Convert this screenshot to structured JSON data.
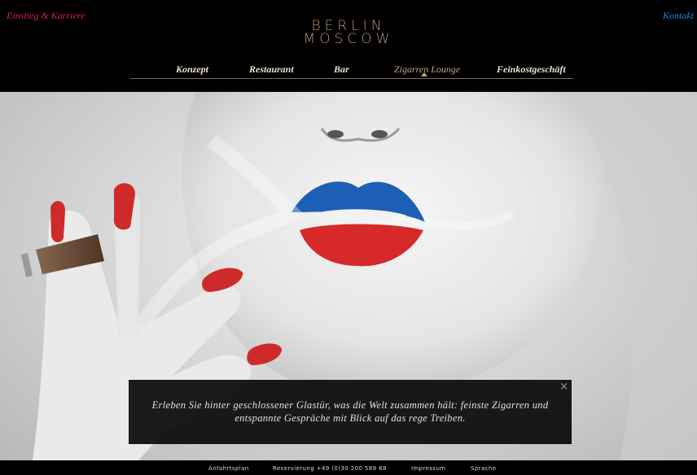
{
  "header": {
    "career_link": "Einstieg & Karriere",
    "contact_link": "Kontakt",
    "logo_line1": "BERLIN",
    "logo_line2": "MOSCOW"
  },
  "nav": {
    "items": [
      {
        "label": "Konzept"
      },
      {
        "label": "Restaurant"
      },
      {
        "label": "Bar"
      },
      {
        "label": "Zigarren Lounge",
        "active": true
      },
      {
        "label": "Feinkostgeschäft"
      }
    ]
  },
  "caption": {
    "line1": "Erleben Sie hinter geschlossener Glastür, was die Welt zusammen hält: feinste Zigarren und",
    "line2": "entspannte Gespräche mit Blick auf das rege Treiben.",
    "close_icon": "×"
  },
  "footer": {
    "links": [
      {
        "label": "Anfahrtsplan"
      },
      {
        "label": "Reservierung +49 (0)30 200 589 68"
      },
      {
        "label": "Impressum"
      },
      {
        "label": "Sprache"
      }
    ]
  },
  "colors": {
    "career_link": "#d8224a",
    "contact_link": "#1e88d8",
    "logo": "#b89672",
    "nav_active": "#c9a27a",
    "lips_upper": "#1d5fb5",
    "lips_lower": "#d62a2a",
    "nails": "#cf2a2a"
  }
}
